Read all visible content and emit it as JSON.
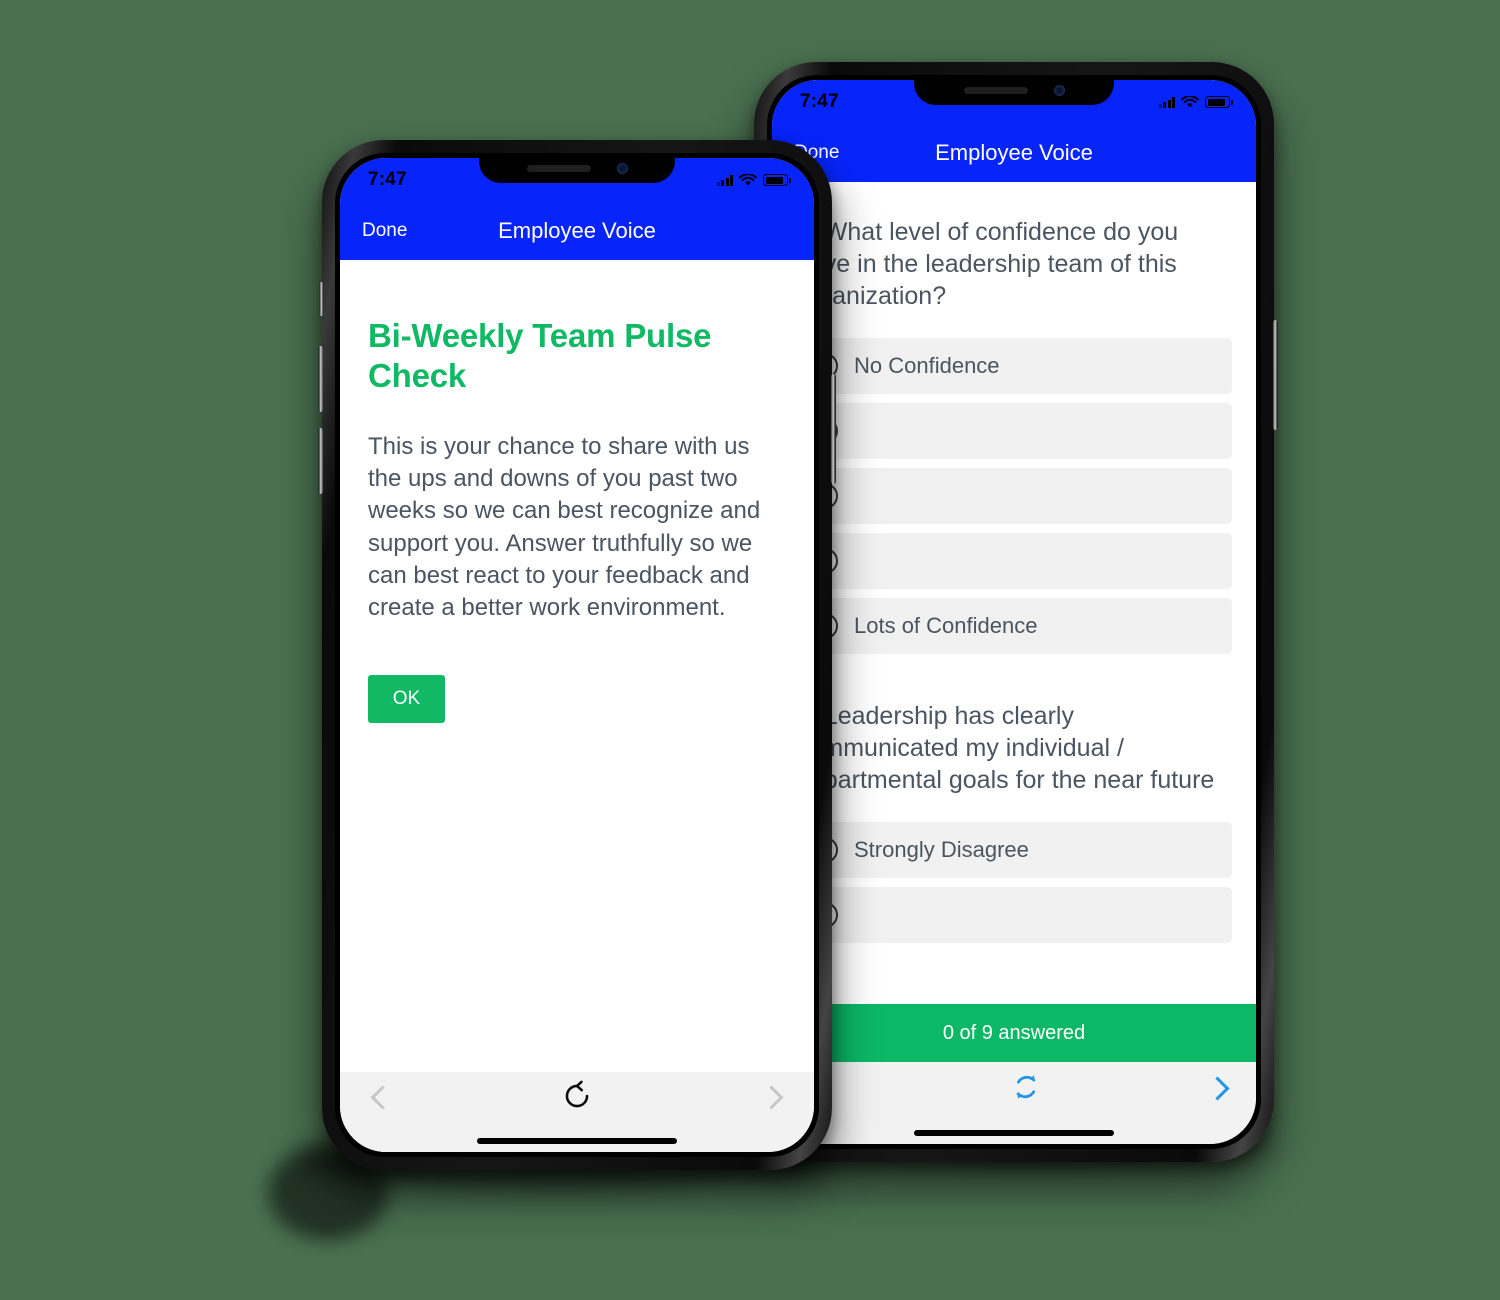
{
  "background_color": "#4a7050",
  "theme": {
    "blue": "#0724fb",
    "green": "#11b964",
    "progress_green": "#0cb866",
    "text_gray": "#4a5561",
    "option_bg": "#f1f1f1",
    "toolbar_bg": "#f2f2f2",
    "link_blue": "#2196e8"
  },
  "front_phone": {
    "status_bar": {
      "time": "7:47",
      "signal_icon": "cellular-signal-icon",
      "wifi_icon": "wifi-icon",
      "battery_icon": "battery-icon"
    },
    "nav": {
      "done_label": "Done",
      "title": "Employee Voice"
    },
    "intro": {
      "heading": "Bi-Weekly Team Pulse Check",
      "body": "This is your chance to share with us the ups and downs of you past two weeks so we can best recognize and support you. Answer truthfully so we can best react to your feedback and create a better work environment.",
      "ok_label": "OK"
    },
    "toolbar": {
      "back_icon": "chevron-left-icon",
      "reload_icon": "reload-icon",
      "forward_icon": "chevron-right-icon",
      "back_enabled": "false",
      "forward_enabled": "false"
    }
  },
  "back_phone": {
    "status_bar": {
      "time": "7:47",
      "signal_icon": "cellular-signal-icon",
      "wifi_icon": "wifi-icon",
      "battery_icon": "battery-icon"
    },
    "nav": {
      "done_label": "Done",
      "title": "Employee Voice"
    },
    "survey": {
      "questions": [
        {
          "text": "1. What level of confidence do you have in the leadership team of this organization?",
          "options": [
            {
              "label": "No Confidence",
              "selected": false
            },
            {
              "label": "",
              "selected": false
            },
            {
              "label": "",
              "selected": false
            },
            {
              "label": "",
              "selected": false
            },
            {
              "label": "Lots of Confidence",
              "selected": false
            }
          ]
        },
        {
          "text": "2. Leadership has clearly communicated my individual / departmental goals for the near future",
          "options": [
            {
              "label": "Strongly Disagree",
              "selected": false
            },
            {
              "label": "",
              "selected": false
            }
          ]
        }
      ],
      "progress_label": "0 of 9 answered"
    },
    "toolbar": {
      "reload_icon": "reload-icon",
      "forward_icon": "chevron-right-icon",
      "forward_enabled": "true"
    }
  }
}
